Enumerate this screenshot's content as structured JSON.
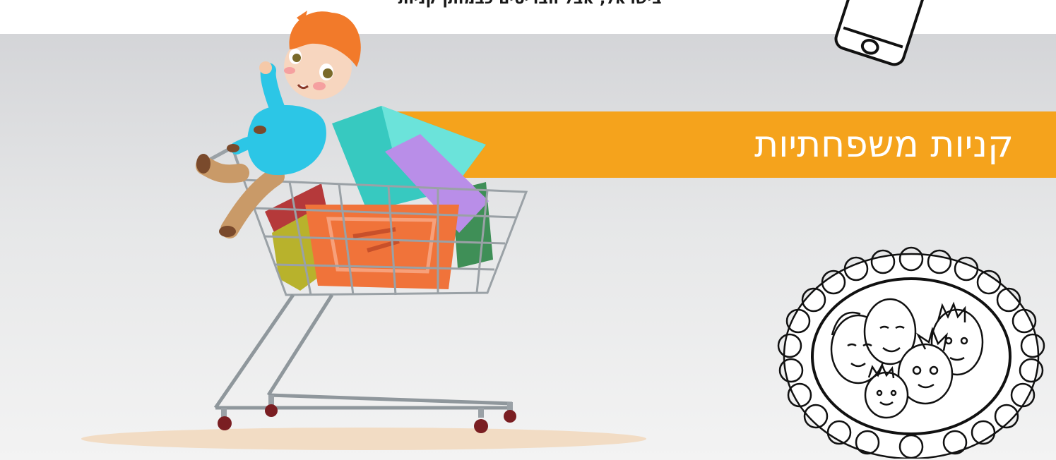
{
  "header": {
    "caption": "בישראל, אבל הבריטים כבמותן קניות"
  },
  "banner": {
    "title": "קניות משפחתיות",
    "color": "#f5a31c"
  },
  "icons": {
    "phone": "phone-icon",
    "family_logo": "family-portrait-logo",
    "cart": "shopping-cart-illustration"
  },
  "colors": {
    "background_top": "#d4d5d8",
    "background_bottom": "#f3f3f3",
    "banner": "#f5a31c",
    "title_text": "#ffffff"
  }
}
